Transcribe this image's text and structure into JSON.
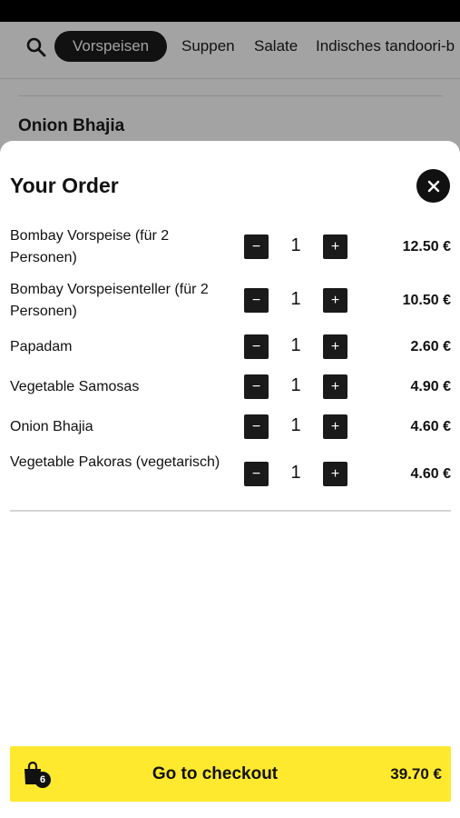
{
  "categories": [
    "Vorspeisen",
    "Suppen",
    "Salate",
    "Indisches tandoori-b"
  ],
  "active_category": "Vorspeisen",
  "background_item": {
    "title": "Onion Bhajia"
  },
  "order": {
    "title": "Your Order",
    "items": [
      {
        "name": "Bombay Vorspeise (für 2 Personen)",
        "qty": "1",
        "price": "12.50 €"
      },
      {
        "name": "Bombay Vorspeisenteller (für 2 Personen)",
        "qty": "1",
        "price": "10.50 €"
      },
      {
        "name": "Papadam",
        "qty": "1",
        "price": "2.60 €"
      },
      {
        "name": "Vegetable Samosas",
        "qty": "1",
        "price": "4.90 €"
      },
      {
        "name": "Onion Bhajia",
        "qty": "1",
        "price": "4.60 €"
      },
      {
        "name": "Vegetable Pakoras (vegetarisch)",
        "qty": "1",
        "price": "4.60 €"
      }
    ],
    "minus_symbol": "−",
    "plus_symbol": "+"
  },
  "checkout": {
    "label": "Go to checkout",
    "total": "39.70 €",
    "item_count": "6"
  },
  "icons": {
    "search": "search-icon",
    "close": "close-icon",
    "bag": "shopping-bag-icon"
  },
  "colors": {
    "accent_yellow": "#ffe92e",
    "dark": "#111111"
  }
}
